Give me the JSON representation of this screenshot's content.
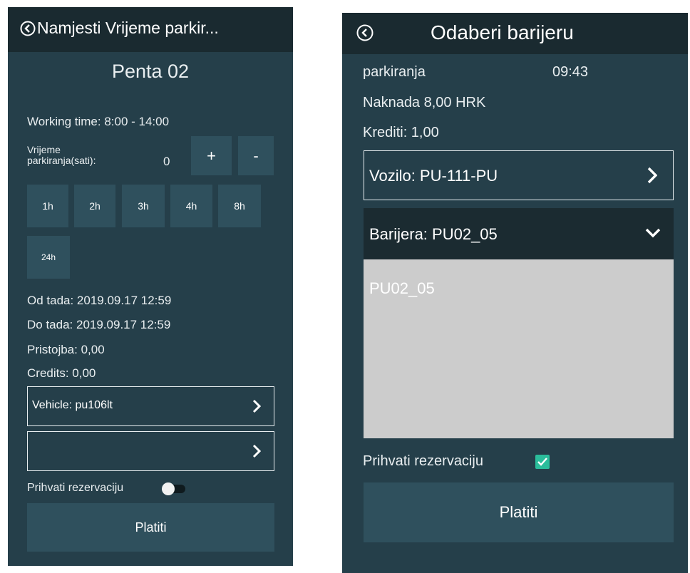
{
  "colors": {
    "panel": "#253f4a",
    "header": "#1a2a30",
    "button": "#2f505d",
    "dropdown_header": "#1b2b31",
    "list_bg": "#cccccc",
    "checkbox": "#2bbd9b"
  },
  "left": {
    "header_title": "Namjesti Vrijeme parkir...",
    "back_icon": "chevron-left-circle-icon",
    "location_title": "Penta 02",
    "working_time": "Working time: 8:00 - 14:00",
    "parking_label_line1": "Vrijeme",
    "parking_label_line2": "parkiranja(sati):",
    "hours_value": "0",
    "plus_label": "+",
    "minus_label": "-",
    "quick_hours": [
      "1h",
      "2h",
      "3h",
      "4h",
      "8h",
      "24h"
    ],
    "from": "Od tada: 2019.09.17 12:59",
    "to": "Do tada: 2019.09.17 12:59",
    "fee": "Pristojba: 0,00",
    "credits": "Credits: 0,00",
    "vehicle": "Vehicle: pu106lt",
    "second_selector": "",
    "accept_label": "Prihvati rezervaciju",
    "toggle_on": false,
    "pay_label": "Platiti"
  },
  "right": {
    "header_title": "Odaberi barijeru",
    "back_icon": "chevron-left-circle-icon",
    "partial_label": "parkiranja",
    "partial_time": "09:43",
    "fee": "Naknada 8,00  HRK",
    "credits": "Krediti: 1,00",
    "vehicle": "Vozilo: PU-111-PU",
    "barrier": "Barijera: PU02_05",
    "options": [
      "PU02_05"
    ],
    "accept_label": "Prihvati rezervaciju",
    "accept_checked": true,
    "pay_label": "Platiti"
  }
}
